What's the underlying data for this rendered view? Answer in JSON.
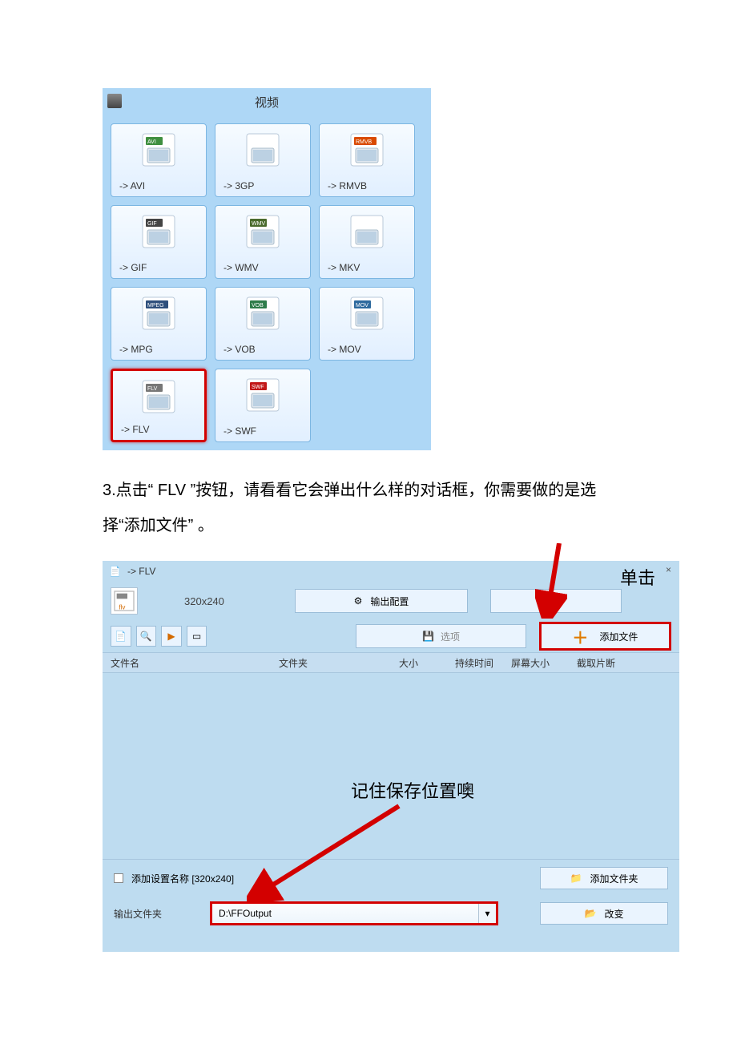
{
  "screenshot1": {
    "title": "视频",
    "tiles": [
      {
        "name": "avi",
        "label": "-> AVI",
        "badge": "AVI",
        "badge_bg": "#3f8f3f"
      },
      {
        "name": "3gp",
        "label": "-> 3GP",
        "badge": "",
        "badge_bg": ""
      },
      {
        "name": "rmvb",
        "label": "-> RMVB",
        "badge": "RMVB",
        "badge_bg": "#d94a00"
      },
      {
        "name": "gif",
        "label": "-> GIF",
        "badge": "GIF",
        "badge_bg": "#444444"
      },
      {
        "name": "wmv",
        "label": "-> WMV",
        "badge": "WMV",
        "badge_bg": "#4a6b2d"
      },
      {
        "name": "mkv",
        "label": "-> MKV",
        "badge": "",
        "badge_bg": "#d28a2e"
      },
      {
        "name": "mpg",
        "label": "-> MPG",
        "badge": "MPEG",
        "badge_bg": "#2e4f7c"
      },
      {
        "name": "vob",
        "label": "-> VOB",
        "badge": "VOB",
        "badge_bg": "#2e7c4a"
      },
      {
        "name": "mov",
        "label": "-> MOV",
        "badge": "MOV",
        "badge_bg": "#2e6a9e"
      },
      {
        "name": "flv",
        "label": "-> FLV",
        "badge": "FLV",
        "badge_bg": "#777777",
        "selected": true
      },
      {
        "name": "swf",
        "label": "-> SWF",
        "badge": "SWF",
        "badge_bg": "#c21818"
      }
    ]
  },
  "instruction": "3.点击“ FLV ”按钮，请看看它会弹出什么样的对话框，你需要做的是选择“添加文件” 。",
  "screenshot2": {
    "title": "-> FLV",
    "close": "×",
    "resolution": "320x240",
    "output_config": "输出配置",
    "options": "选项",
    "add_file": "添加文件",
    "headers": {
      "name": "文件名",
      "folder": "文件夹",
      "size": "大小",
      "duration": "持续时间",
      "screen": "屏幕大小",
      "clip": "截取片断"
    },
    "add_setting_label": "添加设置名称  [320x240]",
    "add_folder": "添加文件夹",
    "output_folder_label": "输出文件夹",
    "output_folder_value": "D:\\FFOutput",
    "change": "改变",
    "anno_click": "单击",
    "anno_save": "记住保存位置噢"
  }
}
